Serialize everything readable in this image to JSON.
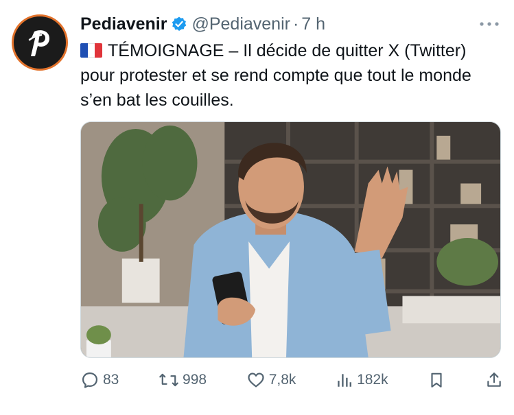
{
  "tweet": {
    "author_name": "Pediavenir",
    "handle": "@Pediavenir",
    "separator": "·",
    "time": "7 h",
    "avatar_letter": "p",
    "text": "TÉMOIGNAGE – Il décide de quitter X (Twitter) pour protester et se rend compte que tout le monde s’en bat les couilles.",
    "flag": "france-flag",
    "media_description": "man-looking-at-phone-photo"
  },
  "actions": {
    "replies": "83",
    "retweets": "998",
    "likes": "7,8k",
    "views": "182k"
  },
  "colors": {
    "verified": "#1d9bf0",
    "avatar_ring": "#e2722b",
    "muted_text": "#536471",
    "text": "#0f1419"
  },
  "icons": [
    "verified-badge-icon",
    "more-icon",
    "reply-icon",
    "retweet-icon",
    "like-icon",
    "views-icon",
    "bookmark-icon",
    "share-icon"
  ]
}
